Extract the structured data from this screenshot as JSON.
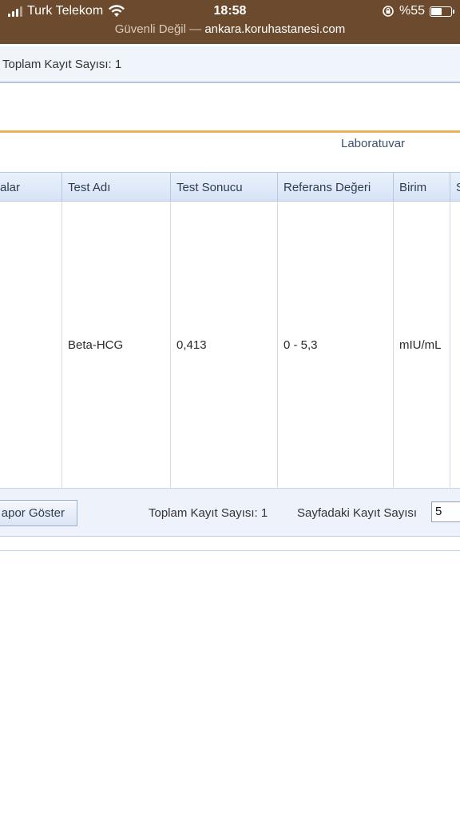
{
  "status_bar": {
    "carrier": "Turk Telekom",
    "time": "18:58",
    "battery_text": "%55",
    "battery_level": 0.55
  },
  "url_bar": {
    "security": "Güvenli Değil —",
    "host": "ankara.koruhastanesi.com"
  },
  "top_summary": {
    "text": "Toplam Kayıt Sayısı: 1"
  },
  "section": {
    "title": "Laboratuvar"
  },
  "table": {
    "headers": [
      "alar",
      "Test Adı",
      "Test Sonucu",
      "Referans Değeri",
      "Birim",
      "S"
    ],
    "rows": [
      [
        "",
        "Beta-HCG",
        "0,413",
        "0 - 5,3",
        "mIU/mL",
        ""
      ]
    ]
  },
  "footer": {
    "rapor_button": "apor Göster",
    "total_label": "Toplam Kayıt Sayısı: 1",
    "per_page_label": "Sayfadaki Kayıt Sayısı",
    "per_page_value": "5"
  },
  "colors": {
    "browser_bar": "#6b4a2e",
    "accent_rule": "#e8b35a",
    "header_bg": "#dbe6f7"
  }
}
